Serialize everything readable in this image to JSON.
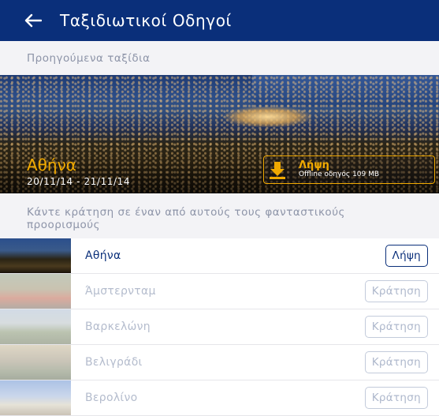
{
  "header": {
    "title": "Ταξιδιωτικοί Οδηγοί"
  },
  "previous_trips": {
    "section_label": "Προηγούμενα ταξίδια",
    "hero": {
      "city": "Αθήνα",
      "dates": "20/11/14 - 21/11/14",
      "download_label": "Λήψη",
      "download_sub": "Offline οδηγός 109 MB"
    }
  },
  "booking": {
    "section_label": "Κάντε κράτηση σε έναν από αυτούς τους φανταστικούς προορισμούς",
    "destinations": [
      {
        "name": "Αθήνα",
        "action": "Λήψη",
        "state": "active"
      },
      {
        "name": "Άμστερνταμ",
        "action": "Κράτηση",
        "state": "muted"
      },
      {
        "name": "Βαρκελώνη",
        "action": "Κράτηση",
        "state": "muted"
      },
      {
        "name": "Βελιγράδι",
        "action": "Κράτηση",
        "state": "muted"
      },
      {
        "name": "Βερολίνο",
        "action": "Κράτηση",
        "state": "muted"
      }
    ]
  },
  "colors": {
    "brand": "#0a2f7a",
    "accent": "#f0a900",
    "muted": "#aeb8cc"
  },
  "icons": {
    "back": "arrow-left-icon",
    "download": "download-icon"
  }
}
